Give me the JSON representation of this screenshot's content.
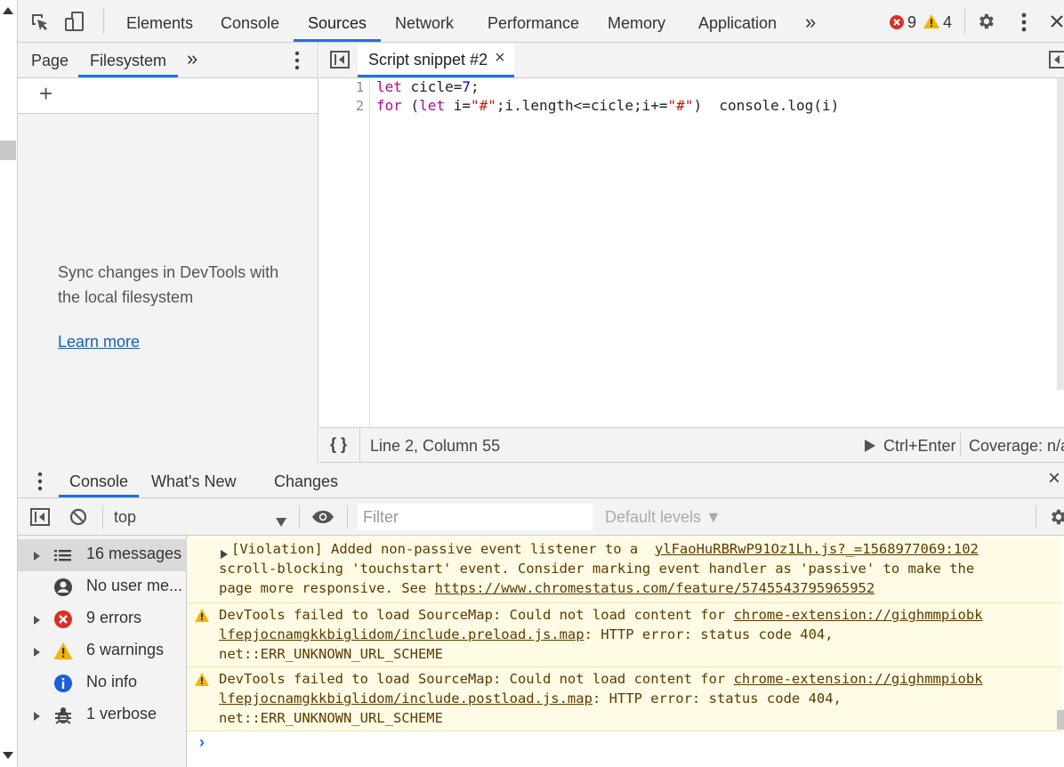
{
  "main_tabs": [
    "Elements",
    "Console",
    "Sources",
    "Network",
    "Performance",
    "Memory",
    "Application"
  ],
  "more_tabs_glyph": "»",
  "error_count": "9",
  "warning_count": "4",
  "navigator": {
    "tabs": [
      "Page",
      "Filesystem"
    ],
    "more_glyph": "»",
    "add_glyph": "+",
    "sync_text": "Sync changes in DevTools with the local filesystem",
    "learn_more": "Learn more"
  },
  "editor": {
    "tab_title": "Script snippet #2",
    "close_glyph": "×",
    "line_numbers": [
      "1",
      "2"
    ]
  },
  "status_bar": {
    "format_glyph": "{ }",
    "position": "Line 2, Column 55",
    "run_label": "Ctrl+Enter",
    "coverage": "Coverage: n/a"
  },
  "drawer": {
    "tabs": [
      "Console",
      "What's New",
      "Changes"
    ],
    "close_glyph": "×"
  },
  "console_toolbar": {
    "context": "top",
    "filter_placeholder": "Filter",
    "levels": "Default levels ▼"
  },
  "console_sidebar": [
    {
      "label": "16 messages",
      "icon": "list-icon",
      "expandable": true
    },
    {
      "label": "No user me...",
      "icon": "user-icon",
      "expandable": false
    },
    {
      "label": "9 errors",
      "icon": "error-icon",
      "expandable": true
    },
    {
      "label": "6 warnings",
      "icon": "warning-icon",
      "expandable": true
    },
    {
      "label": "No info",
      "icon": "info-icon",
      "expandable": false
    },
    {
      "label": "1 verbose",
      "icon": "bug-icon",
      "expandable": true
    }
  ],
  "messages": {
    "violation": {
      "prefix": "[Violation] Added non-passive event listener to a ",
      "source": "ylFaoHuRBRwP91Oz1Lh.js?_=1568977069:102",
      "line2": "scroll-blocking 'touchstart' event. Consider marking event handler as 'passive' to make the",
      "line3_prefix": "page more responsive. See ",
      "url": "https://www.chromestatus.com/feature/5745543795965952"
    },
    "warn1": {
      "prefix": "DevTools failed to load SourceMap: Could not load content for ",
      "link_a": "chrome-extension://gighmmpiobk",
      "link_b": "lfepjocnamgkkbiglidom/include.preload.js.map",
      "suffix": ": HTTP error: status code 404,",
      "line3": "net::ERR_UNKNOWN_URL_SCHEME"
    },
    "warn2": {
      "prefix": "DevTools failed to load SourceMap: Could not load content for ",
      "link_a": "chrome-extension://gighmmpiobk",
      "link_b": "lfepjocnamgkkbiglidom/include.postload.js.map",
      "suffix": ": HTTP error: status code 404,",
      "line3": "net::ERR_UNKNOWN_URL_SCHEME"
    }
  },
  "prompt_glyph": "›",
  "colors": {
    "accent": "#1a73e8",
    "error": "#d93025",
    "warning": "#f4b400",
    "warning_bg": "#fffbe5"
  }
}
